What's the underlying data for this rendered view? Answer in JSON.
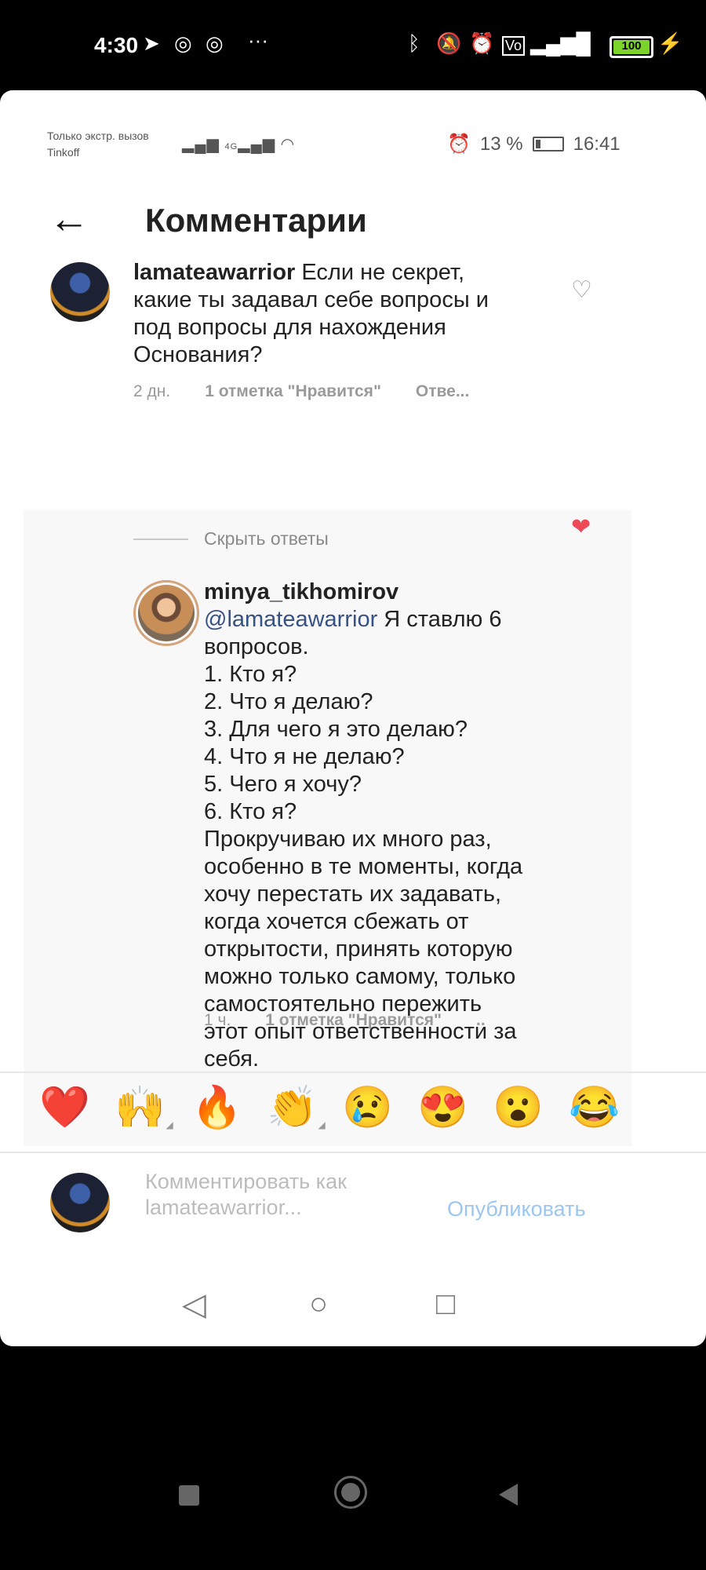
{
  "outer_status": {
    "time": "4:30",
    "dots": "···",
    "icons": [
      "telegram-icon",
      "instagram-icon",
      "instagram-icon",
      "bluetooth-icon",
      "mute-icon",
      "alarm-icon",
      "volte-icon",
      "signal-icon",
      "wifi-icon",
      "battery-icon",
      "charging-icon"
    ],
    "battery_label": "100"
  },
  "inner_status": {
    "carrier_line1": "Только экстр. вызов",
    "carrier_line2": "Tinkoff",
    "network_label": "4G",
    "battery_percent": "13 %",
    "time": "16:41"
  },
  "header": {
    "back_icon": "arrow-left-icon",
    "title": "Комментарии"
  },
  "comment": {
    "username": "lamateawarrior",
    "text": "Если не секрет, какие ты задавал себе вопросы и под вопросы для нахождения Основания?",
    "age": "2 дн.",
    "likes": "1 отметка \"Нравится\"",
    "reply": "Отве...",
    "liked": false
  },
  "hide_replies": "Скрыть ответы",
  "reply": {
    "username": "minya_tikhomirov",
    "mention": "@lamateawarrior",
    "lines": [
      "Я ставлю 6",
      "вопросов.",
      "1. Кто я?",
      "2. Что я делаю?",
      "3. Для чего я это делаю?",
      "4. Что я не делаю?",
      "5. Чего я хочу?",
      "6. Кто я?",
      "Прокручиваю их много раз,",
      "особенно в те моменты, когда",
      "хочу перестать их задавать,",
      "когда хочется сбежать от",
      "открытости, принять которую",
      "можно только самому, только",
      "самостоятельно пережить",
      "этот опыт ответственности за",
      "себя."
    ],
    "age": "1 ч.",
    "likes": "1 отметка \"Нравится\"",
    "more": "..",
    "liked": true,
    "like_color": "#ed4956"
  },
  "reactions": [
    {
      "name": "red-heart",
      "emoji": "❤️"
    },
    {
      "name": "raising-hands",
      "emoji": "🙌"
    },
    {
      "name": "fire",
      "emoji": "🔥"
    },
    {
      "name": "clapping-hands",
      "emoji": "👏"
    },
    {
      "name": "crying-face",
      "emoji": "😢"
    },
    {
      "name": "heart-eyes",
      "emoji": "😍"
    },
    {
      "name": "astonished-face",
      "emoji": "😮"
    },
    {
      "name": "tears-of-joy",
      "emoji": "😂"
    }
  ],
  "composer": {
    "placeholder": "Комментировать как lamateawarrior...",
    "publish": "Опубликовать",
    "publish_color": "#9cc6ef"
  },
  "inner_nav": {
    "back": "◁",
    "home": "○",
    "recents": "□"
  }
}
